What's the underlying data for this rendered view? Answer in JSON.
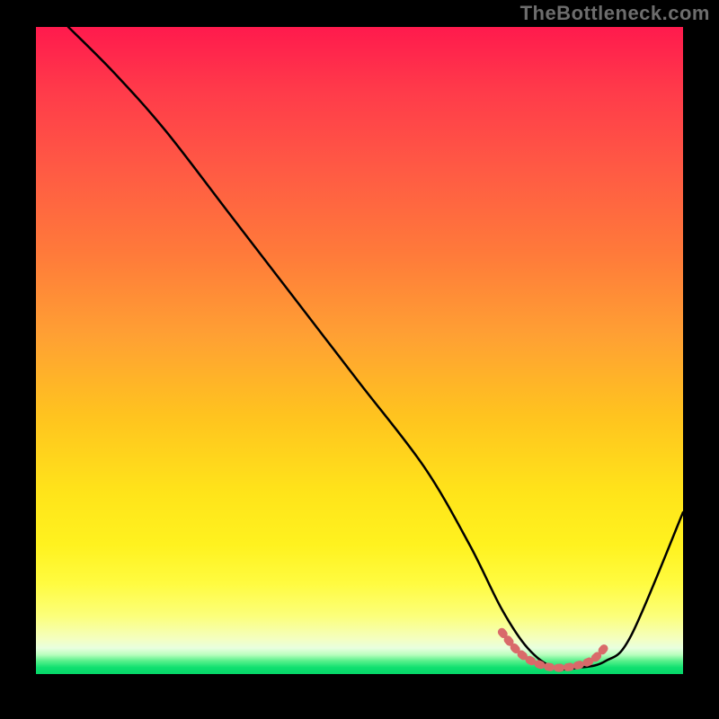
{
  "watermark": "TheBottleneck.com",
  "chart_data": {
    "type": "line",
    "title": "",
    "xlabel": "",
    "ylabel": "",
    "xlim": [
      0,
      100
    ],
    "ylim": [
      0,
      100
    ],
    "grid": false,
    "legend": false,
    "series": [
      {
        "name": "bottleneck-curve",
        "x": [
          5,
          12,
          20,
          30,
          40,
          50,
          60,
          67,
          72,
          76,
          80,
          84,
          88,
          92,
          100
        ],
        "values": [
          100,
          93,
          84,
          71,
          58,
          45,
          32,
          20,
          10,
          4,
          1,
          1,
          2,
          6,
          25
        ],
        "color": "#000000"
      }
    ],
    "highlight": {
      "name": "optimal-range",
      "color": "#d96a6a",
      "x": [
        72,
        74.5,
        77,
        80,
        83,
        86,
        88
      ],
      "values": [
        6.5,
        3.5,
        1.8,
        1.0,
        1.2,
        2.2,
        4.2
      ]
    },
    "background_gradient_stops": [
      {
        "pos": 0,
        "color": "#ff1a4d"
      },
      {
        "pos": 0.35,
        "color": "#ff7a3a"
      },
      {
        "pos": 0.6,
        "color": "#ffc31f"
      },
      {
        "pos": 0.86,
        "color": "#fffb40"
      },
      {
        "pos": 0.97,
        "color": "#b9ffbe"
      },
      {
        "pos": 1.0,
        "color": "#05d668"
      }
    ]
  }
}
